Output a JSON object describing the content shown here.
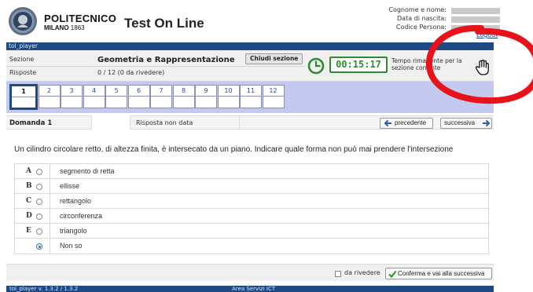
{
  "header": {
    "university_name": "POLITECNICO",
    "university_city": "MILANO",
    "university_year": "1863",
    "app_title": "Test On Line",
    "user_fields": [
      "Cognome e nome:",
      "Data di nascita:",
      "Codice Persona:"
    ],
    "logout_label": "Logout"
  },
  "frame_label": "tol_player",
  "section": {
    "label": "Sezione",
    "name": "Geometria e Rappresentazione",
    "close_label": "Chiudi sezione",
    "answers_label": "Risposte",
    "answers_value": "0 / 12 (0 da rivedere)"
  },
  "timer": {
    "value": "00:15:17",
    "note": "Tempo rimanente per la sezione corrente",
    "color": "#2e8b2e"
  },
  "question_tabs": [
    "1",
    "2",
    "3",
    "4",
    "5",
    "6",
    "7",
    "8",
    "9",
    "10",
    "11",
    "12"
  ],
  "selected_tab": "1",
  "question_nav": {
    "label": "Domanda 1",
    "status": "Risposta non data",
    "prev_label": "precedente",
    "next_label": "successiva"
  },
  "question_text": "Un cilindro circolare retto, di altezza finita, è intersecato da un piano. Indicare quale forma non può mai prendere l'intersezione",
  "options": [
    {
      "letter": "A",
      "text": "segmento di retta",
      "selected": false
    },
    {
      "letter": "B",
      "text": "ellisse",
      "selected": false
    },
    {
      "letter": "C",
      "text": "rettangolo",
      "selected": false
    },
    {
      "letter": "D",
      "text": "circonferenza",
      "selected": false
    },
    {
      "letter": "E",
      "text": "triangolo",
      "selected": false
    },
    {
      "letter": "",
      "text": "Non so",
      "selected": true
    }
  ],
  "actions": {
    "review_label": "da rivedere",
    "confirm_label": "Conferma e vai alla successiva"
  },
  "footer": {
    "version": "tol_player v. 1.3.2 / 1.3.2",
    "area": "Area Servizi ICT"
  },
  "icons": {
    "clock": "clock-icon",
    "hand": "hand-pointer-icon",
    "prev": "arrow-left-icon",
    "next": "arrow-right-icon",
    "confirm": "check-icon",
    "seal": "university-seal-icon"
  },
  "colors": {
    "brand_blue": "#1d4a82",
    "tab_strip": "#c4c9f0",
    "annotation_red": "#e8121b"
  }
}
